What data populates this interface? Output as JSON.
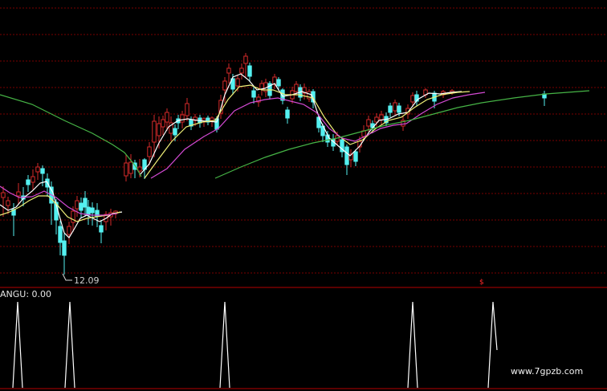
{
  "chart": {
    "low_price_label": "12.09",
    "indicator_label": "ANGU: 0.00",
    "watermark": "www.7gpzb.com",
    "marker": "$"
  },
  "colors": {
    "background": "#000000",
    "grid": "#7a0000",
    "separator": "#b40000",
    "up_candle": "#d42a2a",
    "down_candle": "#54f0f0",
    "ma_short": "#ffffff",
    "ma_mid": "#f0f078",
    "ma_long": "#d34ad3",
    "ma_trend": "#46b446",
    "indicator_line": "#ffffff"
  },
  "chart_data": {
    "type": "candlestick",
    "low_annotation": 12.09,
    "indicator": {
      "name": "ANGU",
      "value": 0.0
    }
  }
}
